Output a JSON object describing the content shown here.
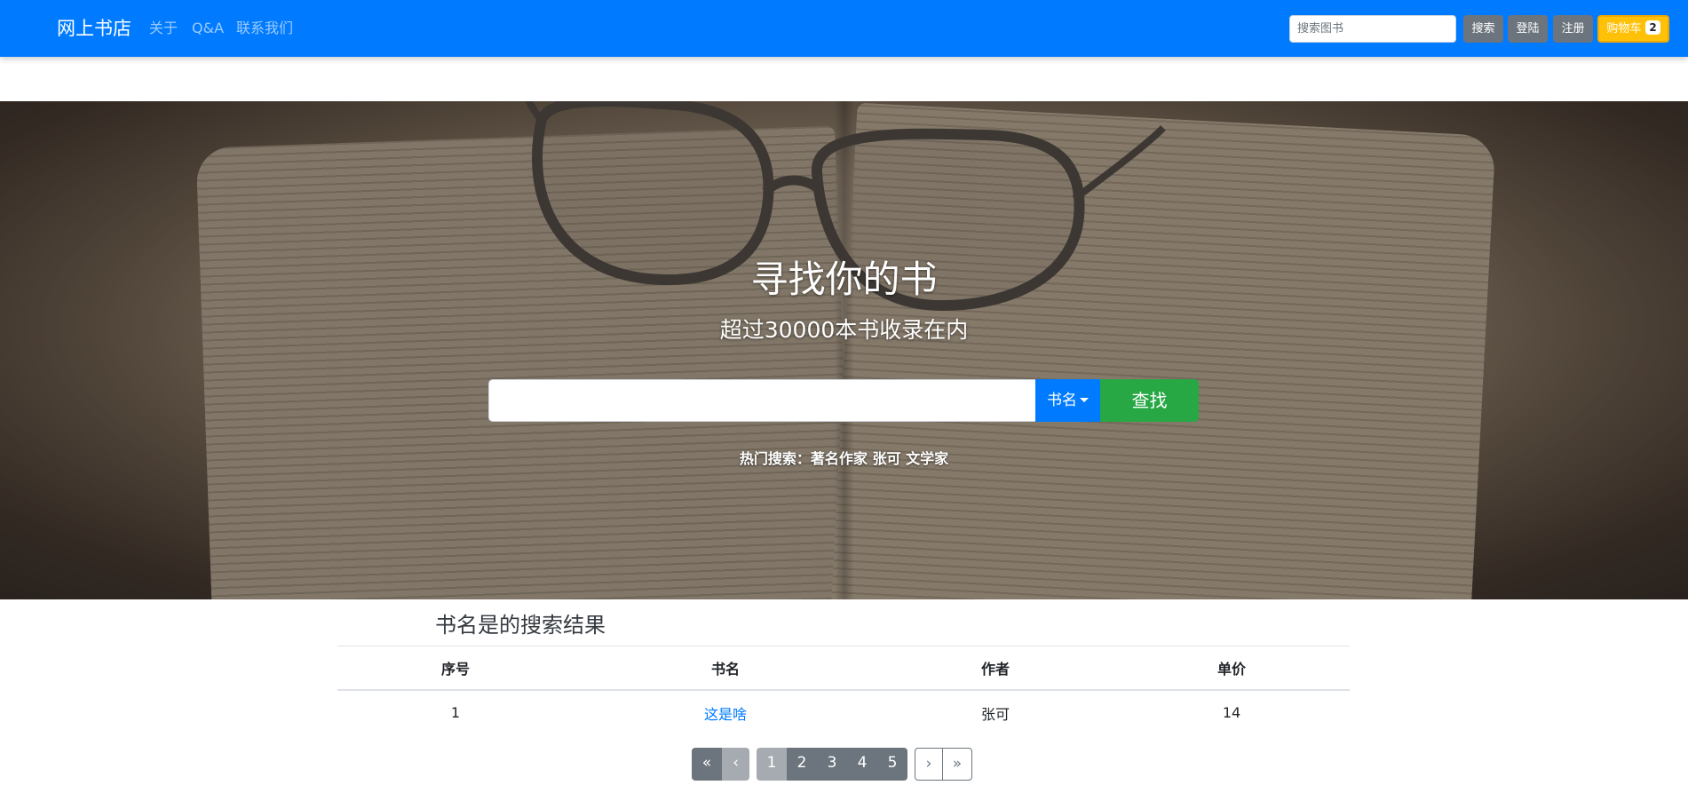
{
  "navbar": {
    "brand": "网上书店",
    "links": [
      "关于",
      "Q&A",
      "联系我们"
    ],
    "search_placeholder": "搜索图书",
    "search_button": "搜索",
    "login_button": "登陆",
    "register_button": "注册",
    "cart_label": "购物车",
    "cart_count": "2"
  },
  "hero": {
    "title": "寻找你的书",
    "subtitle": "超过30000本书收录在内",
    "search_type": "书名",
    "find_button": "查找",
    "hot_label": "热门搜索：",
    "hot_terms": [
      "著名作家",
      "张可",
      "文学家"
    ]
  },
  "results": {
    "title": "书名是的搜索结果",
    "columns": [
      "序号",
      "书名",
      "作者",
      "单价"
    ],
    "rows": [
      {
        "index": "1",
        "name": "这是啥",
        "author": "张可",
        "price": "14"
      }
    ]
  },
  "pagination": {
    "first": "«",
    "prev": "‹",
    "pages": [
      "1",
      "2",
      "3",
      "4",
      "5"
    ],
    "current": "1",
    "next": "›",
    "last": "»"
  },
  "colors": {
    "navbar": "#007bff",
    "cart_button": "#ffc107",
    "find_button": "#28a745",
    "secondary": "#6c757d",
    "link": "#007bff"
  }
}
